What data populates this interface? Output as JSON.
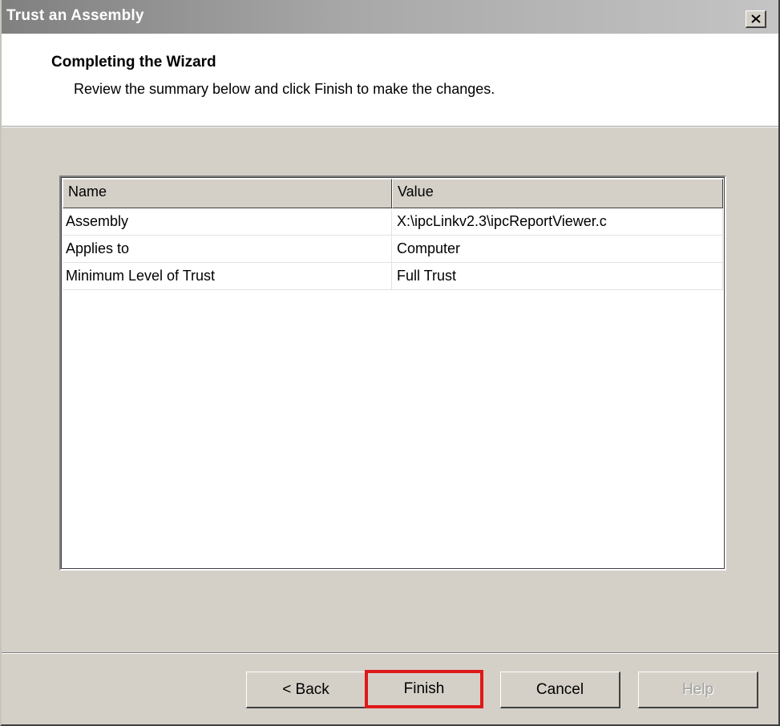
{
  "window": {
    "title": "Trust an Assembly",
    "close_glyph": "✕"
  },
  "header": {
    "heading": "Completing the Wizard",
    "subheading": "Review the summary below and click Finish to make the changes."
  },
  "summary": {
    "columns": [
      "Name",
      "Value"
    ],
    "rows": [
      {
        "name": "Assembly",
        "value": "X:\\ipcLinkv2.3\\ipcReportViewer.c"
      },
      {
        "name": "Applies to",
        "value": "Computer"
      },
      {
        "name": "Minimum Level of Trust",
        "value": "Full Trust"
      }
    ]
  },
  "buttons": {
    "back": "< Back",
    "finish": "Finish",
    "cancel": "Cancel",
    "help": "Help"
  },
  "colors": {
    "dialog_face": "#d4d0c8",
    "highlight_frame": "#e01818"
  }
}
